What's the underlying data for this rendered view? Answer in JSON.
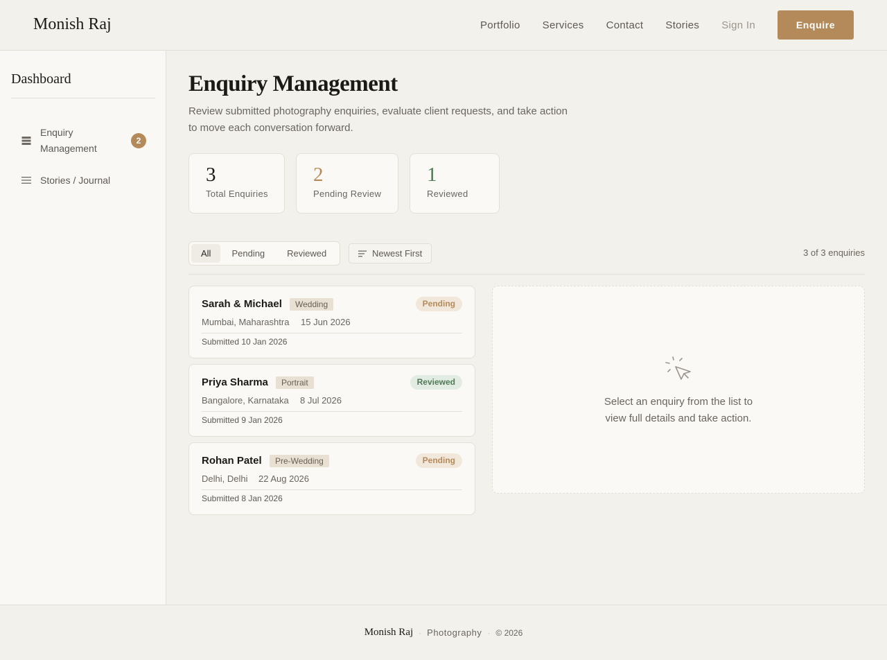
{
  "header": {
    "brand": "Monish Raj",
    "nav": [
      "Portfolio",
      "Services",
      "Contact",
      "Stories"
    ],
    "sign_in": "Sign In",
    "enquire": "Enquire"
  },
  "sidebar": {
    "title": "Dashboard",
    "items": [
      {
        "label": "Enquiry Management",
        "badge": "2",
        "icon": "stack-icon"
      },
      {
        "label": "Stories / Journal",
        "icon": "menu-lines-icon"
      }
    ]
  },
  "main": {
    "title": "Enquiry Management",
    "subtitle_line1": "Review submitted photography enquiries, evaluate client requests, and take action",
    "subtitle_line2": "to move each conversation forward.",
    "stats": [
      {
        "value": "3",
        "label": "Total Enquiries",
        "color": "#1c1a17"
      },
      {
        "value": "2",
        "label": "Pending Review",
        "color": "#b58a5a"
      },
      {
        "value": "1",
        "label": "Reviewed",
        "color": "#4f7a55"
      }
    ],
    "filters": [
      "All",
      "Pending",
      "Reviewed"
    ],
    "active_filter": "All",
    "sort_label": "Newest First",
    "count_text": "3 of 3 enquiries",
    "enquiries": [
      {
        "name": "Sarah & Michael",
        "type": "Wedding",
        "status": "Pending",
        "location": "Mumbai, Maharashtra",
        "date": "15 Jun 2026",
        "submitted": "Submitted 10 Jan 2026"
      },
      {
        "name": "Priya Sharma",
        "type": "Portrait",
        "status": "Reviewed",
        "location": "Bangalore, Karnataka",
        "date": "8 Jul 2026",
        "submitted": "Submitted 9 Jan 2026"
      },
      {
        "name": "Rohan Patel",
        "type": "Pre-Wedding",
        "status": "Pending",
        "location": "Delhi, Delhi",
        "date": "22 Aug 2026",
        "submitted": "Submitted 8 Jan 2026"
      }
    ],
    "empty_state": {
      "line1": "Select an enquiry from the list to",
      "line2": "view full details and take action.",
      "icon": "cursor-click-icon"
    }
  },
  "footer": {
    "brand": "Monish Raj",
    "text": "Photography",
    "copyright": "© 2026"
  },
  "colors": {
    "accent": "#b58a5a",
    "reviewed": "#4f7a55",
    "background": "#f3f1ec"
  }
}
